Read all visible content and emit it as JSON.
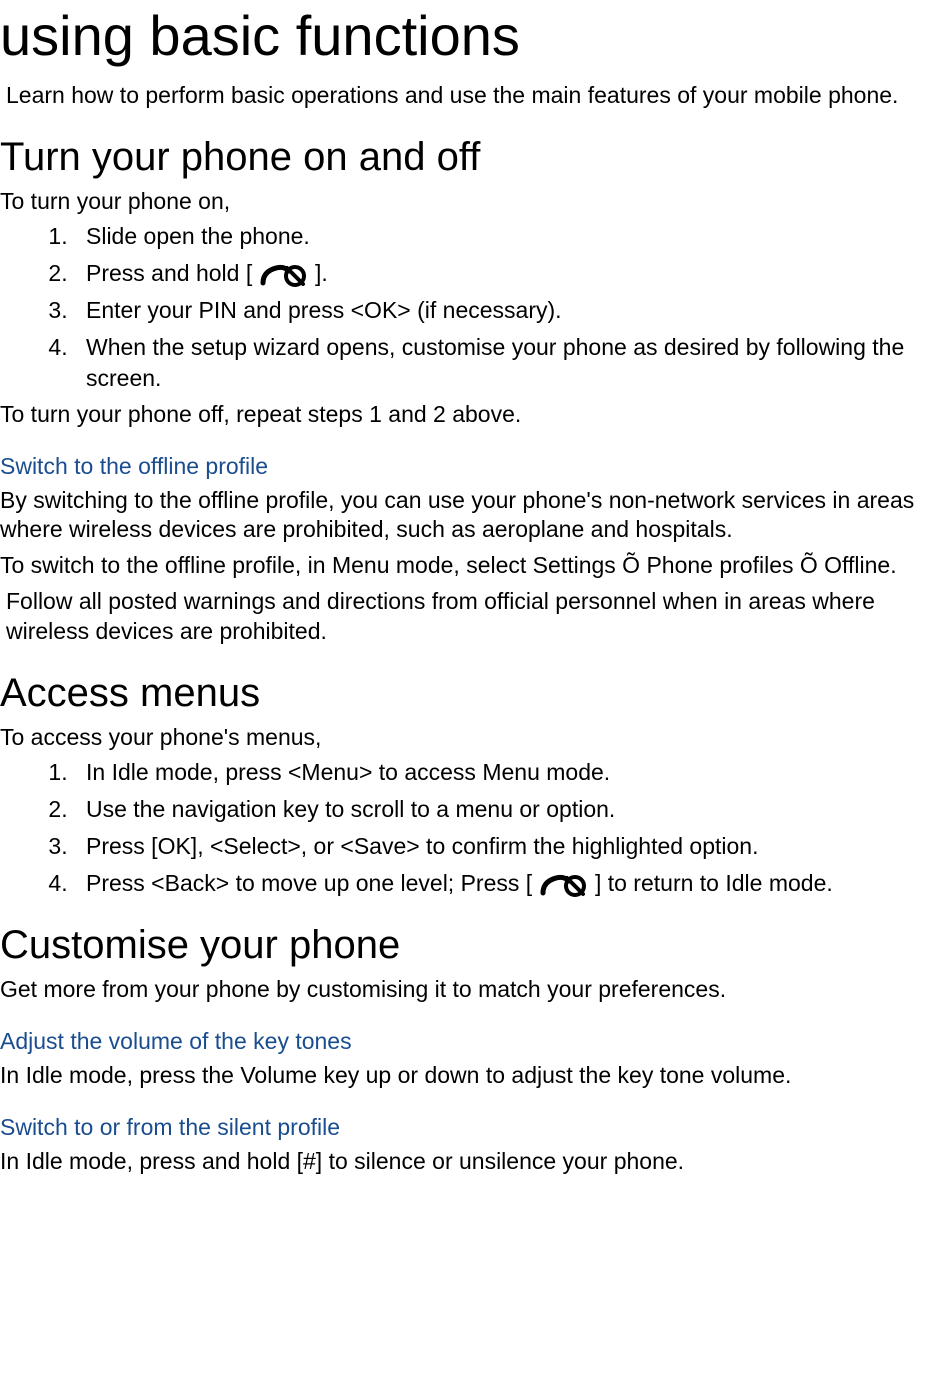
{
  "page_title": "using basic functions",
  "intro": " Learn how to perform basic operations and use the main features of your mobile phone.",
  "section_turn_on": {
    "heading": "Turn your phone on and off",
    "lead": "To turn your phone on,",
    "steps": {
      "s1": "Slide open the phone.",
      "s2_before": "Press and hold [",
      "s2_after": "].",
      "s3": "Enter your PIN and press <OK> (if necessary).",
      "s4": "When the setup wizard opens, customise your phone as desired by following the screen."
    },
    "trail": "To turn your phone off, repeat steps 1 and 2 above."
  },
  "section_offline": {
    "heading": "Switch to the offline profile",
    "p1": "By switching to the offline profile, you can use your phone's non-network services in areas where wireless devices are prohibited, such as aeroplane and hospitals.",
    "p2": "To switch to the offline profile, in Menu mode, select Settings Õ Phone profiles Õ Offline.",
    "note": "Follow all posted warnings and directions from official personnel when in areas where wireless devices are prohibited."
  },
  "section_access": {
    "heading": "Access menus",
    "lead": "To access your phone's menus,",
    "steps": {
      "s1": "In Idle mode, press <Menu> to access Menu mode.",
      "s2": "Use the navigation key to scroll to a menu or option.",
      "s3": "Press [OK], <Select>, or <Save> to confirm the highlighted option.",
      "s4_before": "Press <Back> to move up one level; Press [",
      "s4_after": "] to return to Idle mode."
    }
  },
  "section_customise": {
    "heading": "Customise your phone",
    "lead": "Get more from your phone by customising it to match your preferences."
  },
  "section_volume": {
    "heading": "Adjust the volume of the key tones",
    "p1": "In Idle mode, press the Volume key up or down to adjust the key tone volume."
  },
  "section_silent": {
    "heading": "Switch to or from the silent profile",
    "p1": "In Idle mode, press and hold [#] to silence or unsilence your phone."
  }
}
